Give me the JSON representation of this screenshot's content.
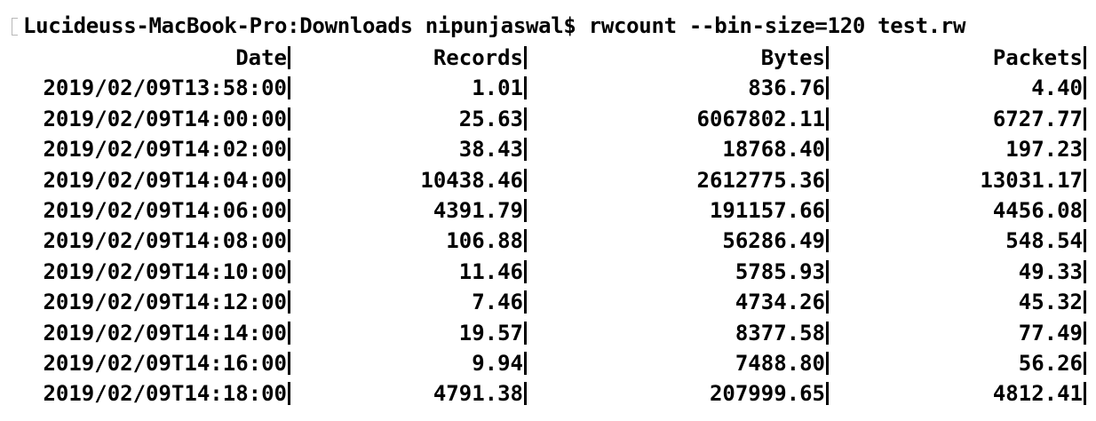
{
  "terminal": {
    "prompt": "Lucideuss-MacBook-Pro:Downloads nipunjaswal$ rwcount --bin-size=120 test.rw",
    "text_color": "#000000",
    "background_color": "#ffffff"
  },
  "table": {
    "headers": [
      "Date",
      "Records",
      "Bytes",
      "Packets"
    ],
    "rows": [
      [
        "2019/02/09T13:58:00",
        "1.01",
        "836.76",
        "4.40"
      ],
      [
        "2019/02/09T14:00:00",
        "25.63",
        "6067802.11",
        "6727.77"
      ],
      [
        "2019/02/09T14:02:00",
        "38.43",
        "18768.40",
        "197.23"
      ],
      [
        "2019/02/09T14:04:00",
        "10438.46",
        "2612775.36",
        "13031.17"
      ],
      [
        "2019/02/09T14:06:00",
        "4391.79",
        "191157.66",
        "4456.08"
      ],
      [
        "2019/02/09T14:08:00",
        "106.88",
        "56286.49",
        "548.54"
      ],
      [
        "2019/02/09T14:10:00",
        "11.46",
        "5785.93",
        "49.33"
      ],
      [
        "2019/02/09T14:12:00",
        "7.46",
        "4734.26",
        "45.32"
      ],
      [
        "2019/02/09T14:14:00",
        "19.57",
        "8377.58",
        "77.49"
      ],
      [
        "2019/02/09T14:16:00",
        "9.94",
        "7488.80",
        "56.26"
      ],
      [
        "2019/02/09T14:18:00",
        "4791.38",
        "207999.65",
        "4812.41"
      ]
    ]
  }
}
